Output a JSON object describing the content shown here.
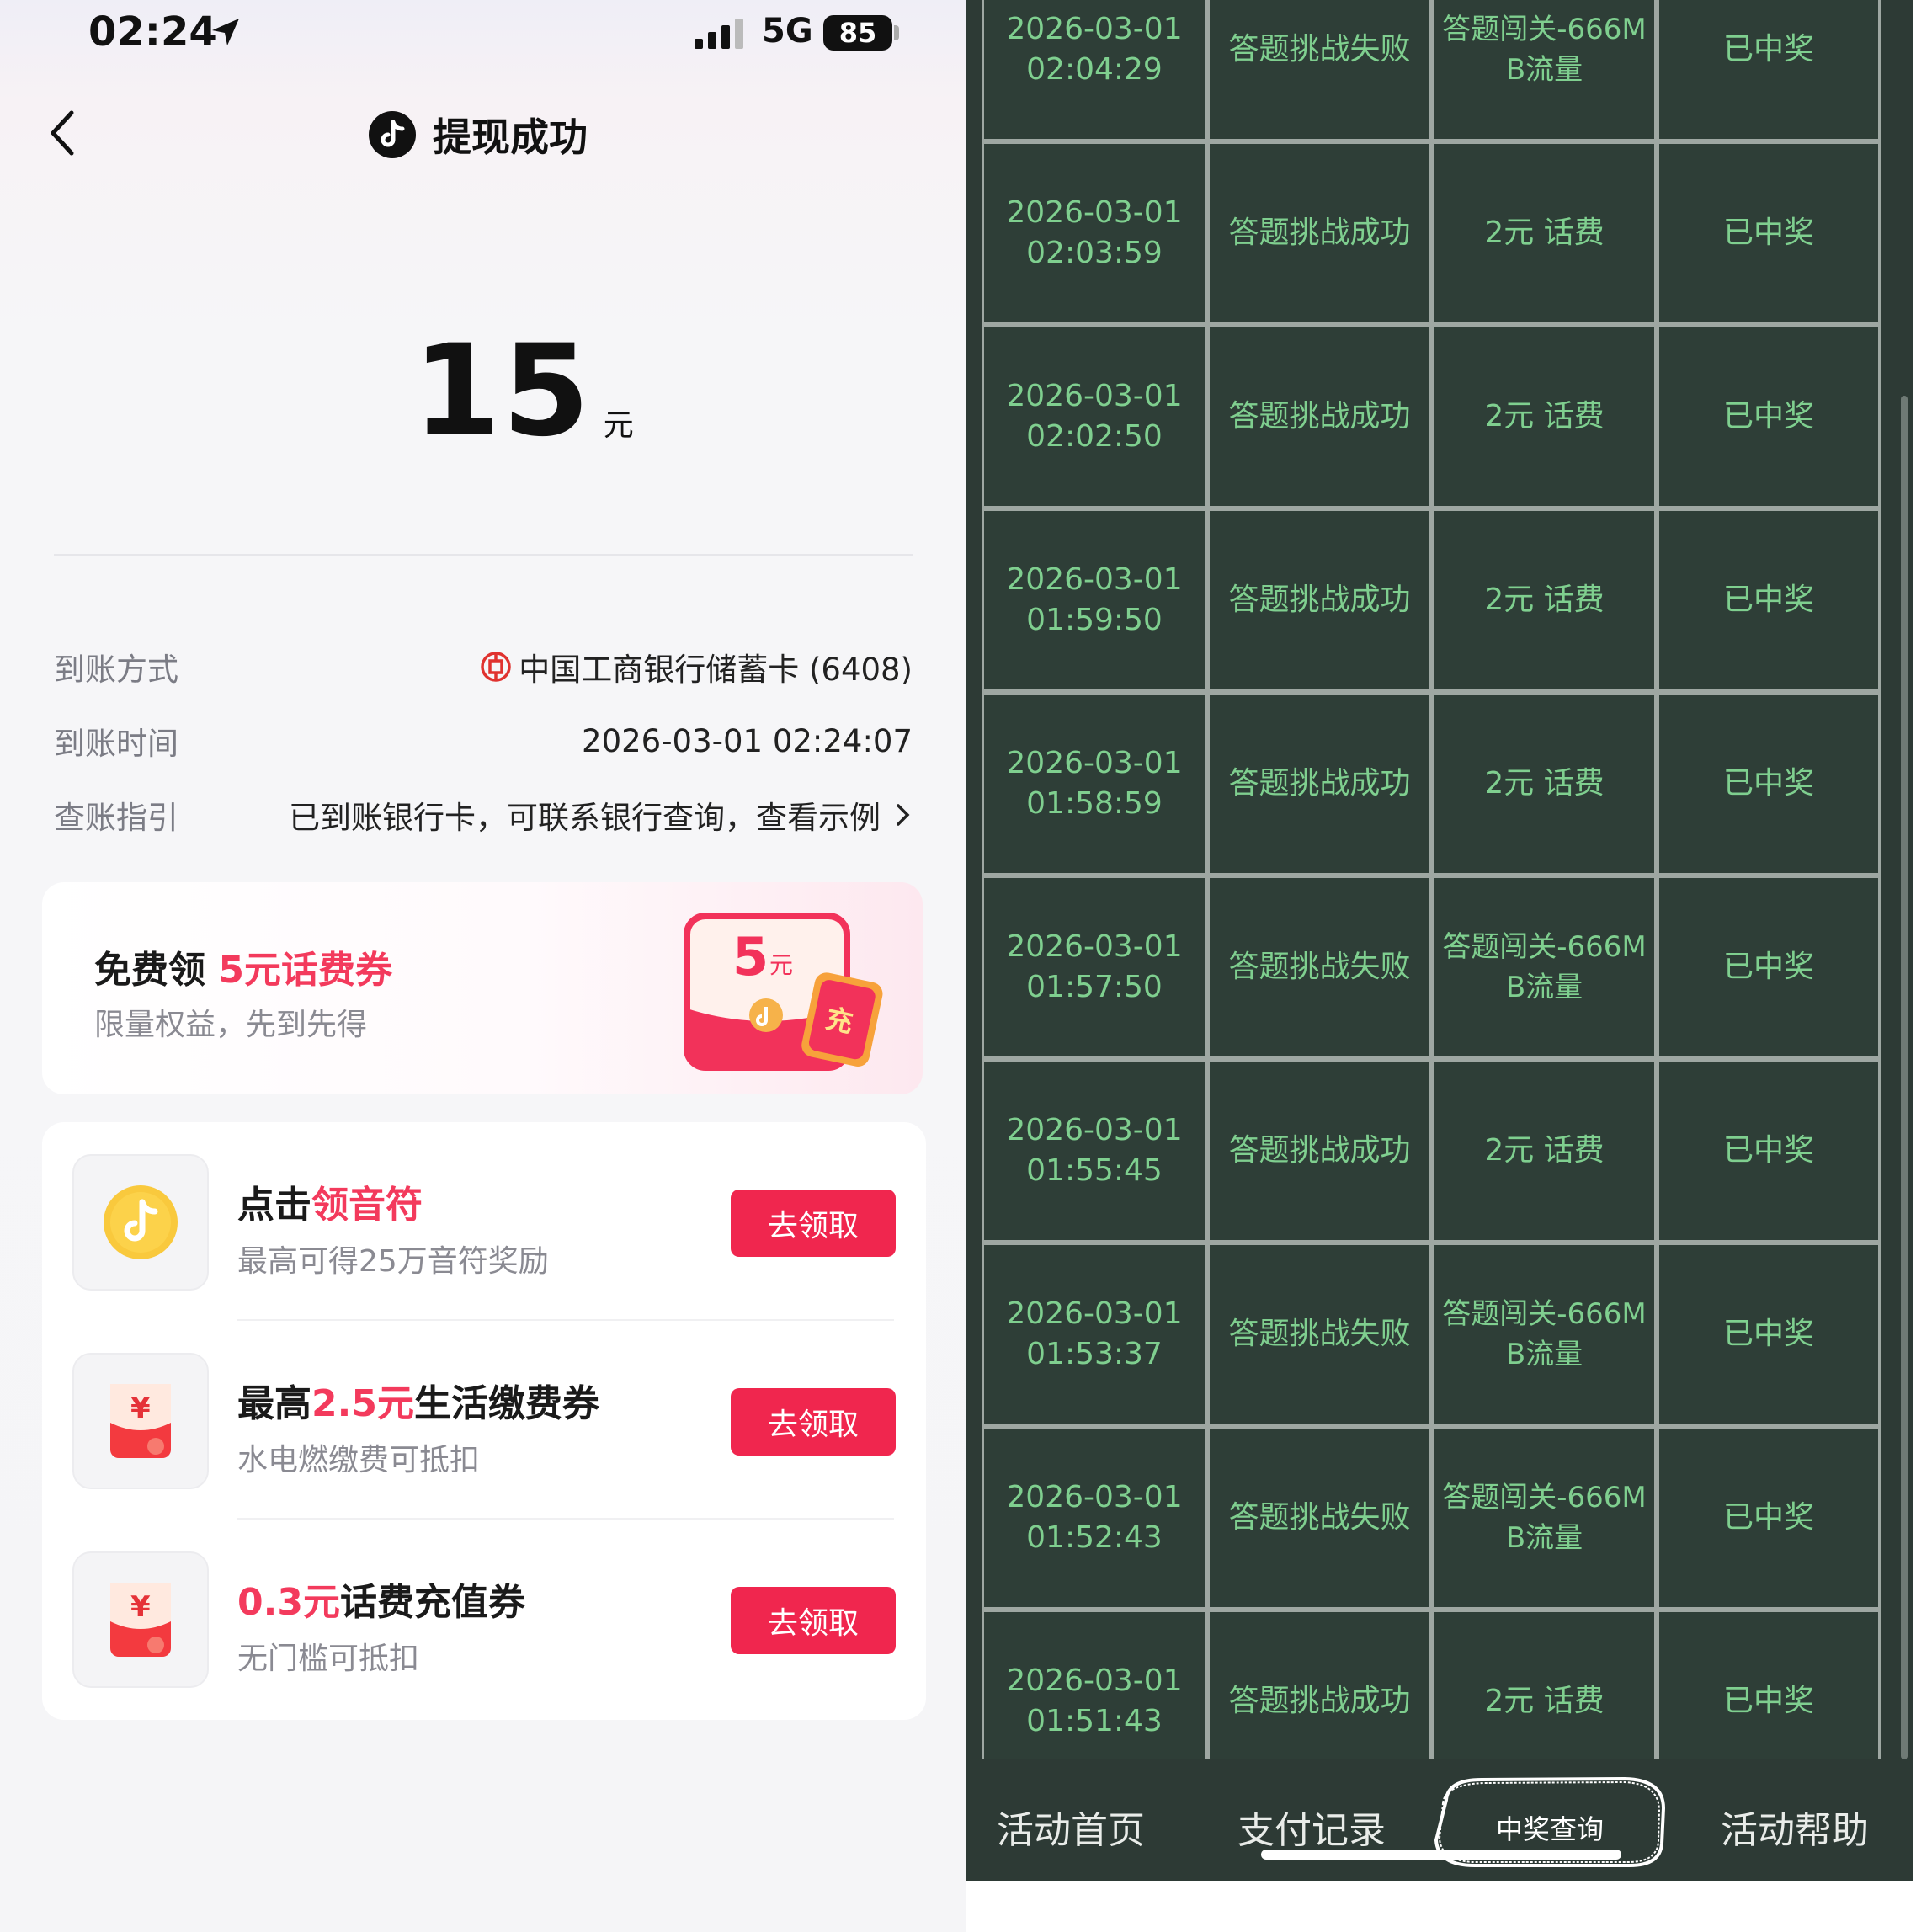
{
  "left": {
    "status_bar": {
      "time": "02:24",
      "network": "5G",
      "battery": "85"
    },
    "header": {
      "title": "提现成功"
    },
    "amount": {
      "value": "15",
      "unit": "元"
    },
    "info": [
      {
        "label": "到账方式",
        "value": "中国工商银行储蓄卡 (6408)"
      },
      {
        "label": "到账时间",
        "value": "2026-03-01 02:24:07"
      },
      {
        "label": "查账指引",
        "value": "已到账银行卡，可联系银行查询，查看示例"
      }
    ],
    "promo": {
      "title_prefix": "免费领 ",
      "title_highlight": "5元话费券",
      "subtitle": "限量权益，先到先得",
      "art_amount": "5",
      "art_unit": "元",
      "art_badge": "充"
    },
    "tasks": [
      {
        "title_pre": "点击",
        "title_hl": "领音符",
        "title_post": "",
        "subtitle": "最高可得25万音符奖励",
        "button": "去领取",
        "icon": "music-note-coin-icon"
      },
      {
        "title_pre": "最高",
        "title_hl": "2.5元",
        "title_post": "生活缴费券",
        "subtitle": "水电燃缴费可抵扣",
        "button": "去领取",
        "icon": "red-envelope-icon"
      },
      {
        "title_pre": "",
        "title_hl": "0.3元",
        "title_post": "话费充值券",
        "subtitle": "无门槛可抵扣",
        "button": "去领取",
        "icon": "red-envelope-icon"
      }
    ],
    "colors": {
      "accent": "#f33a5c",
      "button": "#f0264e"
    }
  },
  "right": {
    "rows": [
      {
        "date": "2026-03-01",
        "time": "02:04:29",
        "activity": "答题挑战失败",
        "prize_line1": "答题闯关-666M",
        "prize_line2": "B流量",
        "status": "已中奖"
      },
      {
        "date": "2026-03-01",
        "time": "02:03:59",
        "activity": "答题挑战成功",
        "prize_line1": "2元 话费",
        "prize_line2": "",
        "status": "已中奖"
      },
      {
        "date": "2026-03-01",
        "time": "02:02:50",
        "activity": "答题挑战成功",
        "prize_line1": "2元 话费",
        "prize_line2": "",
        "status": "已中奖"
      },
      {
        "date": "2026-03-01",
        "time": "01:59:50",
        "activity": "答题挑战成功",
        "prize_line1": "2元 话费",
        "prize_line2": "",
        "status": "已中奖"
      },
      {
        "date": "2026-03-01",
        "time": "01:58:59",
        "activity": "答题挑战成功",
        "prize_line1": "2元 话费",
        "prize_line2": "",
        "status": "已中奖"
      },
      {
        "date": "2026-03-01",
        "time": "01:57:50",
        "activity": "答题挑战失败",
        "prize_line1": "答题闯关-666M",
        "prize_line2": "B流量",
        "status": "已中奖"
      },
      {
        "date": "2026-03-01",
        "time": "01:55:45",
        "activity": "答题挑战成功",
        "prize_line1": "2元 话费",
        "prize_line2": "",
        "status": "已中奖"
      },
      {
        "date": "2026-03-01",
        "time": "01:53:37",
        "activity": "答题挑战失败",
        "prize_line1": "答题闯关-666M",
        "prize_line2": "B流量",
        "status": "已中奖"
      },
      {
        "date": "2026-03-01",
        "time": "01:52:43",
        "activity": "答题挑战失败",
        "prize_line1": "答题闯关-666M",
        "prize_line2": "B流量",
        "status": "已中奖"
      },
      {
        "date": "2026-03-01",
        "time": "01:51:43",
        "activity": "答题挑战成功",
        "prize_line1": "2元 话费",
        "prize_line2": "",
        "status": "已中奖"
      }
    ],
    "tabs": [
      "活动首页",
      "支付记录",
      "中奖查询",
      "活动帮助"
    ],
    "active_tab": "中奖查询",
    "colors": {
      "board": "#2d3a35",
      "cell_text": "#7fcf8f",
      "grid_line": "#9ea7a2"
    }
  }
}
